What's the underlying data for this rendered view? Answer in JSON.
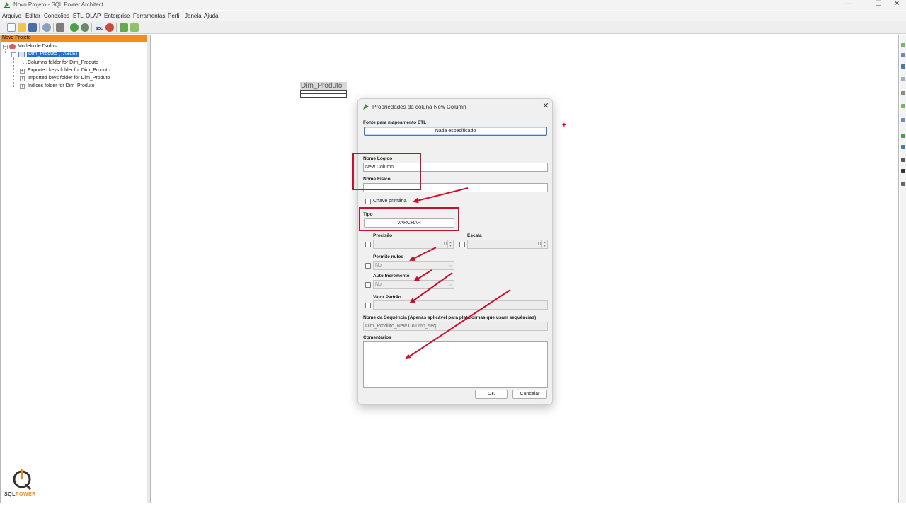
{
  "window": {
    "title": "Novo Projeto - SQL Power Architect",
    "minimize": "—",
    "maximize": "☐",
    "close": "✕"
  },
  "menu": [
    "Arquivo",
    "Editar",
    "Conexões",
    "ETL",
    "OLAP",
    "Enterprise",
    "Ferramentas",
    "Perfil",
    "Janela",
    "Ajuda"
  ],
  "toolbar": {
    "icons": [
      "new-file-icon",
      "open-folder-icon",
      "save-icon",
      "refresh-icon",
      "print-icon",
      "undo-icon",
      "redo-icon",
      "sql-icon",
      "db-connect-icon",
      "sql-export-icon",
      "chart-icon"
    ],
    "sql_label": "SQL"
  },
  "tree": {
    "header": "Novo Projeto",
    "root": "Modelo de Dados",
    "table": "Dim_Produto (TABLE)",
    "children": [
      "Columns folder for Dim_Produto",
      "Exported keys folder for Dim_Produto",
      "Imported keys folder for Dim_Produto",
      "Indices folder for Dim_Produto"
    ]
  },
  "logo": {
    "text_a": "SQL",
    "text_b": "POWER",
    "mark": "Q"
  },
  "canvas": {
    "table_title": "Dim_Produto",
    "crosshair": "+"
  },
  "dialog": {
    "title": "Propriedades da coluna New Column",
    "close": "✕",
    "etl_label": "Fonte para mapeamento ETL",
    "etl_button": "Nada especificado",
    "logical_label": "Nome Lógico",
    "logical_value": "New Column",
    "physical_label": "Nome Físico",
    "physical_value": "",
    "pk_label": "Chave primária",
    "type_label": "Tipo",
    "type_value": "VARCHAR",
    "precision_label": "Precisão",
    "precision_value": "0",
    "scale_label": "Escala",
    "scale_value": "0",
    "nullable_label": "Permite nulos",
    "nullable_value": "No",
    "autoinc_label": "Auto Incremento",
    "autoinc_value": "No",
    "default_label": "Valor Padrão",
    "default_value": "",
    "sequence_label": "Nome da Sequência (Apenas aplicável para plataformas que usam sequências)",
    "sequence_value": "Dim_Produto_New Column_seq",
    "comments_label": "Comentários",
    "ok": "OK",
    "cancel": "Cancelar"
  },
  "annotation_color": "#c8102e",
  "accent_orange": "#f28c1e",
  "selection_blue": "#1f6fd1"
}
